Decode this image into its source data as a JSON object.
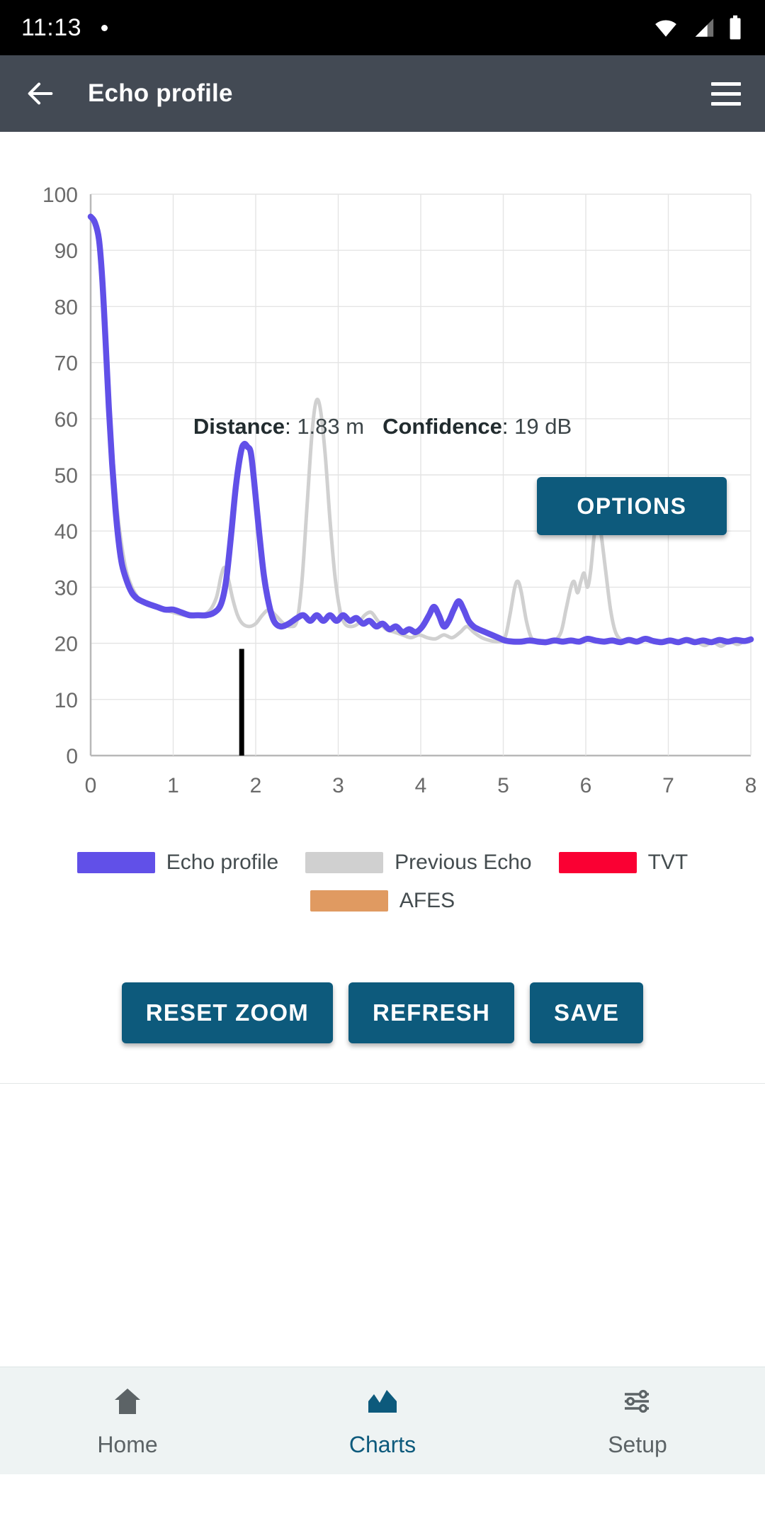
{
  "status_bar": {
    "time": "11:13",
    "icons": [
      "dot-indicator",
      "wifi-icon",
      "cellular-signal-icon",
      "battery-icon"
    ]
  },
  "app_bar": {
    "title": "Echo profile",
    "back_icon": "back-arrow-icon",
    "menu_icon": "hamburger-menu-icon"
  },
  "readout": {
    "distance_label": "Distance",
    "distance_sep": ":",
    "distance_value": "1.83 m",
    "confidence_label": "Confidence",
    "confidence_sep": ":",
    "confidence_value": "19 dB"
  },
  "options_button": {
    "label": "OPTIONS"
  },
  "legend": {
    "rows": [
      [
        {
          "label": "Echo profile",
          "color": "#6150e8"
        },
        {
          "label": "Previous Echo",
          "color": "#d0d0d0"
        },
        {
          "label": "TVT",
          "color": "#fa0033"
        }
      ],
      [
        {
          "label": "AFES",
          "color": "#e09a61"
        }
      ]
    ]
  },
  "actions": [
    {
      "label": "RESET ZOOM"
    },
    {
      "label": "REFRESH"
    },
    {
      "label": "SAVE"
    }
  ],
  "bottom_nav": [
    {
      "label": "Home",
      "icon": "home-icon",
      "active": false
    },
    {
      "label": "Charts",
      "icon": "chart-icon",
      "active": true
    },
    {
      "label": "Setup",
      "icon": "sliders-icon",
      "active": false
    }
  ],
  "chart_data": {
    "type": "line",
    "title": "",
    "xlabel": "",
    "ylabel": "",
    "xlim": [
      0,
      8
    ],
    "ylim": [
      0,
      100
    ],
    "xticks": [
      0,
      1,
      2,
      3,
      4,
      5,
      6,
      7,
      8
    ],
    "yticks": [
      0,
      10,
      20,
      30,
      40,
      50,
      60,
      70,
      80,
      90,
      100
    ],
    "grid": true,
    "legend_position": "bottom",
    "colors": {
      "echo_profile": "#6150e8",
      "previous_echo": "#d0d0d0",
      "tvt": "#fa0033",
      "afes": "#e09a61",
      "marker": "#000000",
      "grid": "#e4e4e4",
      "axis": "#b8b8b8"
    },
    "marker": {
      "name": "distance-marker",
      "x": 1.83,
      "y0": 0,
      "y1": 19
    },
    "series": [
      {
        "name": "Echo profile",
        "color": "#6150e8",
        "points": [
          [
            0.0,
            96
          ],
          [
            0.05,
            95
          ],
          [
            0.1,
            92
          ],
          [
            0.14,
            85
          ],
          [
            0.18,
            74
          ],
          [
            0.22,
            62
          ],
          [
            0.26,
            52
          ],
          [
            0.3,
            44
          ],
          [
            0.34,
            38
          ],
          [
            0.38,
            34
          ],
          [
            0.44,
            31
          ],
          [
            0.5,
            29
          ],
          [
            0.56,
            28
          ],
          [
            0.62,
            27.5
          ],
          [
            0.7,
            27
          ],
          [
            0.8,
            26.5
          ],
          [
            0.9,
            26
          ],
          [
            1.0,
            26
          ],
          [
            1.1,
            25.5
          ],
          [
            1.2,
            25
          ],
          [
            1.3,
            25
          ],
          [
            1.4,
            25
          ],
          [
            1.5,
            25.5
          ],
          [
            1.58,
            27
          ],
          [
            1.64,
            31
          ],
          [
            1.7,
            39
          ],
          [
            1.76,
            48
          ],
          [
            1.82,
            54
          ],
          [
            1.86,
            55.5
          ],
          [
            1.9,
            55
          ],
          [
            1.94,
            54
          ],
          [
            1.98,
            49
          ],
          [
            2.04,
            40
          ],
          [
            2.1,
            32
          ],
          [
            2.16,
            27
          ],
          [
            2.22,
            24
          ],
          [
            2.3,
            23
          ],
          [
            2.4,
            23.5
          ],
          [
            2.5,
            24.5
          ],
          [
            2.58,
            25
          ],
          [
            2.66,
            24
          ],
          [
            2.74,
            25
          ],
          [
            2.82,
            24
          ],
          [
            2.9,
            25
          ],
          [
            2.98,
            24
          ],
          [
            3.06,
            25
          ],
          [
            3.14,
            24
          ],
          [
            3.22,
            24.5
          ],
          [
            3.3,
            23.5
          ],
          [
            3.38,
            24
          ],
          [
            3.46,
            23
          ],
          [
            3.54,
            23.5
          ],
          [
            3.62,
            22.5
          ],
          [
            3.7,
            23
          ],
          [
            3.78,
            22
          ],
          [
            3.86,
            22.5
          ],
          [
            3.94,
            22
          ],
          [
            4.02,
            23
          ],
          [
            4.1,
            25
          ],
          [
            4.16,
            26.5
          ],
          [
            4.22,
            25
          ],
          [
            4.28,
            23
          ],
          [
            4.34,
            24
          ],
          [
            4.4,
            26
          ],
          [
            4.46,
            27.5
          ],
          [
            4.52,
            26
          ],
          [
            4.58,
            24
          ],
          [
            4.64,
            23
          ],
          [
            4.7,
            22.5
          ],
          [
            4.78,
            22
          ],
          [
            4.86,
            21.5
          ],
          [
            4.94,
            21
          ],
          [
            5.02,
            20.5
          ],
          [
            5.12,
            20.3
          ],
          [
            5.22,
            20.3
          ],
          [
            5.32,
            20.5
          ],
          [
            5.42,
            20.3
          ],
          [
            5.52,
            20.2
          ],
          [
            5.62,
            20.5
          ],
          [
            5.72,
            20.3
          ],
          [
            5.82,
            20.5
          ],
          [
            5.92,
            20.3
          ],
          [
            6.02,
            20.8
          ],
          [
            6.12,
            20.5
          ],
          [
            6.22,
            20.3
          ],
          [
            6.32,
            20.5
          ],
          [
            6.42,
            20.2
          ],
          [
            6.52,
            20.6
          ],
          [
            6.62,
            20.3
          ],
          [
            6.72,
            20.8
          ],
          [
            6.82,
            20.4
          ],
          [
            6.92,
            20.2
          ],
          [
            7.02,
            20.5
          ],
          [
            7.12,
            20.2
          ],
          [
            7.22,
            20.6
          ],
          [
            7.32,
            20.2
          ],
          [
            7.42,
            20.5
          ],
          [
            7.52,
            20.2
          ],
          [
            7.62,
            20.6
          ],
          [
            7.72,
            20.3
          ],
          [
            7.82,
            20.6
          ],
          [
            7.92,
            20.4
          ],
          [
            8.0,
            20.7
          ]
        ]
      },
      {
        "name": "Previous Echo",
        "color": "#d0d0d0",
        "points": [
          [
            0.0,
            96
          ],
          [
            0.06,
            94
          ],
          [
            0.12,
            88
          ],
          [
            0.17,
            77
          ],
          [
            0.22,
            64
          ],
          [
            0.27,
            53
          ],
          [
            0.32,
            44
          ],
          [
            0.37,
            38
          ],
          [
            0.43,
            33
          ],
          [
            0.5,
            30
          ],
          [
            0.58,
            28
          ],
          [
            0.66,
            27
          ],
          [
            0.76,
            26.5
          ],
          [
            0.88,
            26
          ],
          [
            1.0,
            25.5
          ],
          [
            1.14,
            25
          ],
          [
            1.28,
            25
          ],
          [
            1.42,
            25.5
          ],
          [
            1.52,
            28
          ],
          [
            1.58,
            32
          ],
          [
            1.62,
            33.5
          ],
          [
            1.66,
            32
          ],
          [
            1.72,
            28
          ],
          [
            1.78,
            25
          ],
          [
            1.84,
            23.5
          ],
          [
            1.92,
            23
          ],
          [
            2.0,
            23.5
          ],
          [
            2.08,
            25
          ],
          [
            2.16,
            26
          ],
          [
            2.24,
            25
          ],
          [
            2.34,
            23.5
          ],
          [
            2.42,
            23
          ],
          [
            2.5,
            24
          ],
          [
            2.56,
            31
          ],
          [
            2.62,
            44
          ],
          [
            2.68,
            57
          ],
          [
            2.73,
            63
          ],
          [
            2.78,
            62
          ],
          [
            2.84,
            54
          ],
          [
            2.9,
            42
          ],
          [
            2.96,
            32
          ],
          [
            3.02,
            26
          ],
          [
            3.08,
            23.5
          ],
          [
            3.16,
            23
          ],
          [
            3.24,
            23.5
          ],
          [
            3.32,
            25
          ],
          [
            3.4,
            25.5
          ],
          [
            3.48,
            24
          ],
          [
            3.58,
            22.5
          ],
          [
            3.68,
            22
          ],
          [
            3.78,
            21.5
          ],
          [
            3.88,
            21
          ],
          [
            3.98,
            21.5
          ],
          [
            4.08,
            21
          ],
          [
            4.18,
            20.8
          ],
          [
            4.28,
            21.5
          ],
          [
            4.38,
            21
          ],
          [
            4.48,
            22
          ],
          [
            4.56,
            23
          ],
          [
            4.64,
            22
          ],
          [
            4.74,
            21
          ],
          [
            4.84,
            20.5
          ],
          [
            4.94,
            20.3
          ],
          [
            5.02,
            21
          ],
          [
            5.08,
            25
          ],
          [
            5.14,
            30
          ],
          [
            5.18,
            31
          ],
          [
            5.22,
            29
          ],
          [
            5.28,
            24
          ],
          [
            5.34,
            21
          ],
          [
            5.42,
            20.3
          ],
          [
            5.52,
            20.2
          ],
          [
            5.62,
            20.5
          ],
          [
            5.7,
            22
          ],
          [
            5.76,
            26
          ],
          [
            5.82,
            30
          ],
          [
            5.86,
            31
          ],
          [
            5.9,
            29
          ],
          [
            5.94,
            31
          ],
          [
            5.98,
            32.5
          ],
          [
            6.02,
            30
          ],
          [
            6.06,
            33
          ],
          [
            6.1,
            39
          ],
          [
            6.14,
            42
          ],
          [
            6.18,
            40
          ],
          [
            6.24,
            33
          ],
          [
            6.3,
            26
          ],
          [
            6.36,
            22
          ],
          [
            6.44,
            20.5
          ],
          [
            6.54,
            20.8
          ],
          [
            6.64,
            20.3
          ],
          [
            6.74,
            21
          ],
          [
            6.84,
            20.4
          ],
          [
            6.94,
            20.2
          ],
          [
            7.04,
            20.6
          ],
          [
            7.14,
            20.2
          ],
          [
            7.24,
            20.8
          ],
          [
            7.34,
            20.3
          ],
          [
            7.44,
            19.6
          ],
          [
            7.54,
            20.2
          ],
          [
            7.64,
            19.5
          ],
          [
            7.74,
            20.3
          ],
          [
            7.84,
            19.8
          ],
          [
            7.92,
            20.4
          ],
          [
            8.0,
            20.6
          ]
        ]
      }
    ]
  }
}
